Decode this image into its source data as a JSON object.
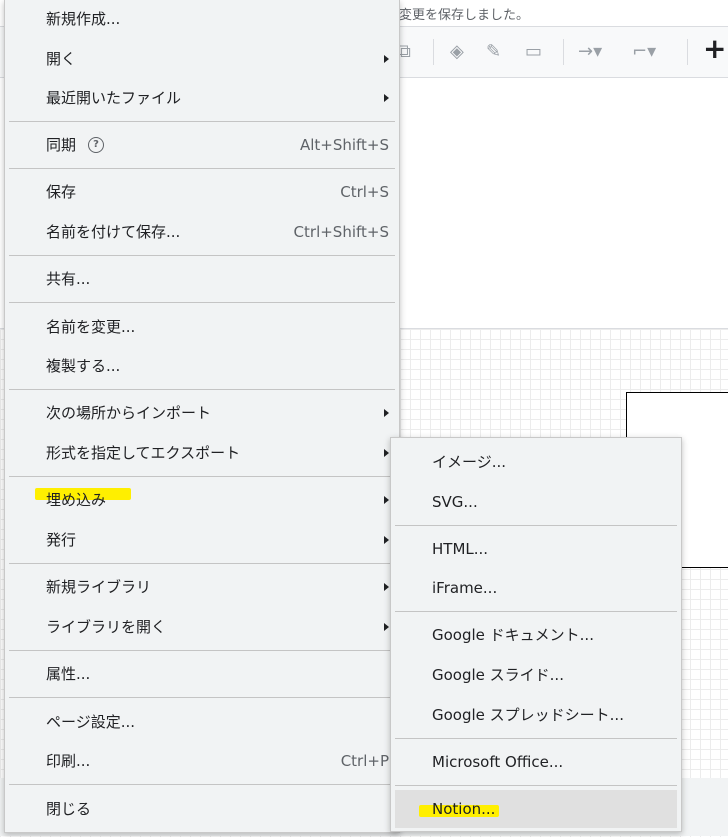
{
  "status": {
    "save_text": "の変更を保存しました。"
  },
  "toolbar": {
    "plus_icon": "+"
  },
  "main_menu": {
    "new": "新規作成...",
    "open": "開く",
    "recent": "最近開いたファイル",
    "sync": "同期",
    "sync_help": "?",
    "sync_shortcut": "Alt+Shift+S",
    "save": "保存",
    "save_shortcut": "Ctrl+S",
    "save_as": "名前を付けて保存...",
    "save_as_shortcut": "Ctrl+Shift+S",
    "share": "共有...",
    "rename": "名前を変更...",
    "duplicate": "複製する...",
    "import_from": "次の場所からインポート",
    "export_as": "形式を指定してエクスポート",
    "embed": "埋め込み",
    "publish": "発行",
    "new_library": "新規ライブラリ",
    "open_library": "ライブラリを開く",
    "properties": "属性...",
    "page_setup": "ページ設定...",
    "print": "印刷...",
    "print_shortcut": "Ctrl+P",
    "close": "閉じる"
  },
  "embed_submenu": {
    "image": "イメージ...",
    "svg": "SVG...",
    "html": "HTML...",
    "iframe": "iFrame...",
    "google_docs": "Google ドキュメント...",
    "google_slides": "Google スライド...",
    "google_sheets": "Google スプレッドシート...",
    "ms_office": "Microsoft Office...",
    "notion": "Notion..."
  },
  "colors": {
    "highlight": "#ffef00",
    "menu_bg": "#f1f3f4",
    "active_item": "#e0e0e0"
  }
}
